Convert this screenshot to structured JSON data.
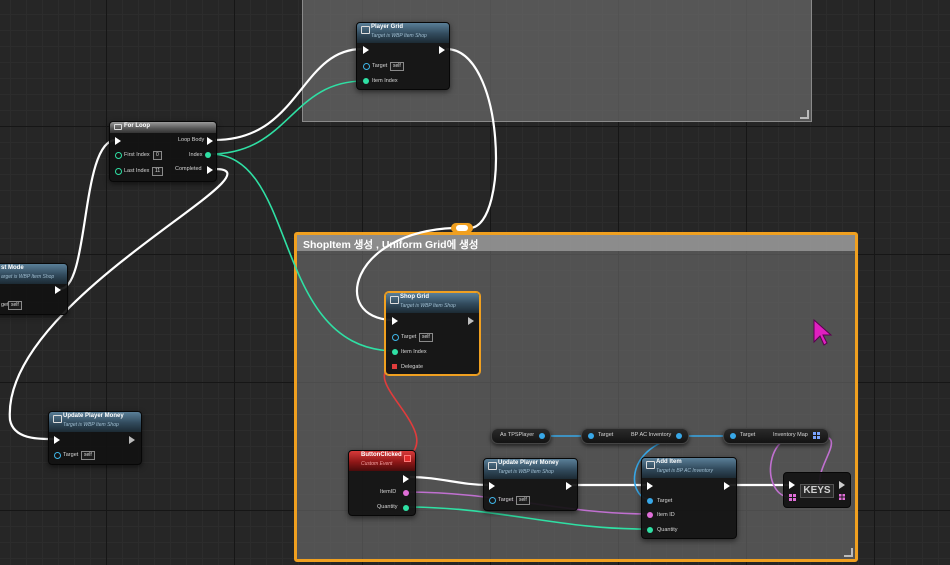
{
  "comments": {
    "shop_comment_title": "ShopItem 생성 , Uniform Grid에 생성"
  },
  "nodes": {
    "player_grid": {
      "title": "Player Grid",
      "subtitle": "Target is WBP Item Shop",
      "target_label": "Target",
      "target_value": "self",
      "item_index_label": "Item Index"
    },
    "for_loop": {
      "title": "For Loop",
      "loop_body_label": "Loop Body",
      "first_index_label": "First Index",
      "first_index_value": "0",
      "index_label": "Index",
      "last_index_label": "Last Index",
      "last_index_value": "11",
      "completed_label": "Completed"
    },
    "partial_node": {
      "title": "st Mode",
      "subtitle": "arget is WBP Item Shop",
      "target_label": "get",
      "target_value": "self"
    },
    "shop_grid": {
      "title": "Shop Grid",
      "subtitle": "Target is WBP Item Shop",
      "target_label": "Target",
      "target_value": "self",
      "item_index_label": "Item Index",
      "delegate_label": "Delegate"
    },
    "update_money_left": {
      "title": "Update Player Money",
      "subtitle": "Target is WBP Item Shop",
      "target_label": "Target",
      "target_value": "self"
    },
    "button_clicked": {
      "title": "ButtonClicked",
      "subtitle": "Custom Event",
      "item_id_label": "ItemID",
      "quantity_label": "Quantity"
    },
    "update_money_inner": {
      "title": "Update Player Money",
      "subtitle": "Target is WBP Item Shop",
      "target_label": "Target",
      "target_value": "self"
    },
    "add_item": {
      "title": "Add Item",
      "subtitle": "Target is BP AC Inventory",
      "target_label": "Target",
      "item_id_label": "Item ID",
      "quantity_label": "Quantity"
    },
    "as_tps_player": {
      "label": "As TPSPlayer"
    },
    "bp_ac_inventory": {
      "target_label": "Target",
      "out_label": "BP AC Inventory"
    },
    "inventory_map": {
      "target_label": "Target",
      "out_label": "Inventory Map"
    },
    "keys": {
      "label": "KEYS"
    }
  },
  "colors": {
    "comment_highlight": "#f0a020",
    "exec_wire": "#ffffff",
    "int_wire": "#2fe0a4",
    "object_wire": "#38a8e8",
    "string_wire": "#e06ed8",
    "delegate_wire": "#e03c3c",
    "cursor": "#e020c0"
  }
}
